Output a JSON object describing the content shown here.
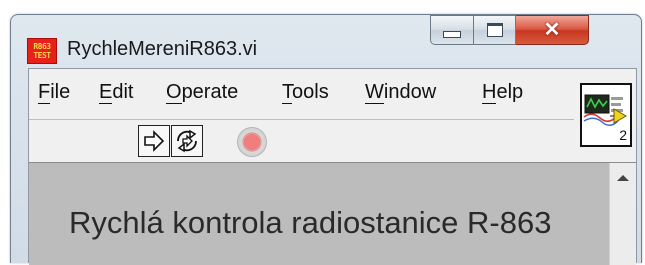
{
  "window": {
    "title": "RychleMereniR863.vi",
    "icon_lines": [
      "R863",
      "TEST"
    ],
    "buttons": {
      "minimize": "minimize-icon",
      "maximize": "maximize-icon",
      "close": "close-icon"
    }
  },
  "menu": [
    {
      "label": "File",
      "mnemonic": "F",
      "rest": "ile"
    },
    {
      "label": "Edit",
      "mnemonic": "E",
      "rest": "dit"
    },
    {
      "label": "Operate",
      "mnemonic": "O",
      "rest": "perate"
    },
    {
      "label": "Tools",
      "mnemonic": "T",
      "rest": "ools"
    },
    {
      "label": "Window",
      "mnemonic": "W",
      "rest": "indow"
    },
    {
      "label": "Help",
      "mnemonic": "H",
      "rest": "elp"
    }
  ],
  "toolbar": {
    "run": "run-arrow-icon",
    "run_continuously": "run-continuously-icon",
    "abort": "abort-stop-icon"
  },
  "vi_icon": {
    "connector_number": "2"
  },
  "panel": {
    "title": "Rychlá kontrola radiostanice R-863",
    "background": "#bcbcbc"
  },
  "colors": {
    "icon_red": "#e8201a",
    "icon_text": "#ffd84a",
    "close_red": "#c7371f",
    "stop_red": "#f07e7e"
  }
}
